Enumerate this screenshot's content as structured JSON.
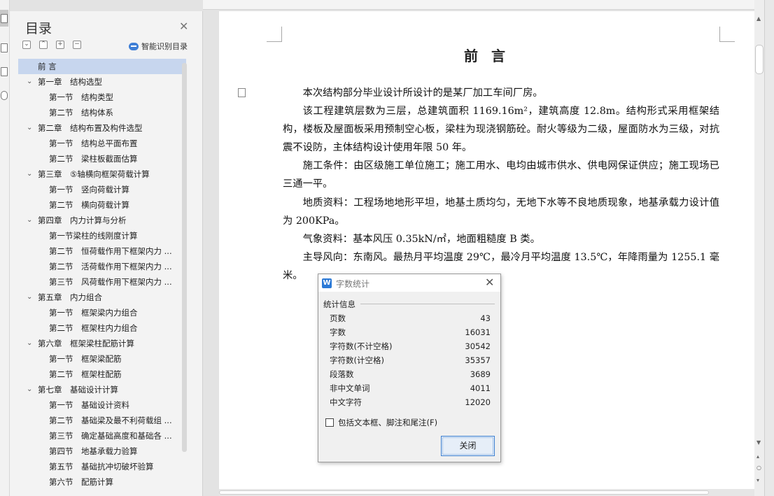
{
  "toc_panel": {
    "title": "目录",
    "smart_label": "智能识别目录",
    "items": [
      {
        "level": 1,
        "label": "前 言",
        "selected": true
      },
      {
        "level": 1,
        "label": "第一章　结构选型",
        "expanded": true
      },
      {
        "level": 2,
        "label": "第一节　结构类型"
      },
      {
        "level": 2,
        "label": "第二节　结构体系"
      },
      {
        "level": 1,
        "label": "第二章　结构布置及构件选型",
        "expanded": true
      },
      {
        "level": 2,
        "label": "第一节　结构总平面布置"
      },
      {
        "level": 2,
        "label": "第二节　梁柱板截面估算"
      },
      {
        "level": 1,
        "label": "第三章　⑤轴横向框架荷载计算",
        "expanded": true
      },
      {
        "level": 2,
        "label": "第一节　竖向荷载计算"
      },
      {
        "level": 2,
        "label": "第二节　横向荷载计算"
      },
      {
        "level": 1,
        "label": "第四章　内力计算与分析",
        "expanded": true
      },
      {
        "level": 2,
        "label": "第一节梁柱的线刚度计算"
      },
      {
        "level": 2,
        "label": "第二节　恒荷载作用下框架内力 ..."
      },
      {
        "level": 2,
        "label": "第二节　活荷载作用下框架内力 ..."
      },
      {
        "level": 2,
        "label": "第三节　风荷载作用下框架内力 ..."
      },
      {
        "level": 1,
        "label": "第五章　内力组合",
        "expanded": true
      },
      {
        "level": 2,
        "label": "第一节　框架梁内力组合"
      },
      {
        "level": 2,
        "label": "第二节　框架柱内力组合"
      },
      {
        "level": 1,
        "label": "第六章　框架梁柱配筋计算",
        "expanded": true
      },
      {
        "level": 2,
        "label": "第一节　框架梁配筋"
      },
      {
        "level": 2,
        "label": "第二节　框架柱配筋"
      },
      {
        "level": 1,
        "label": "第七章　基础设计计算",
        "expanded": true
      },
      {
        "level": 2,
        "label": "第一节　基础设计资料"
      },
      {
        "level": 2,
        "label": "第二节　基础梁及最不利荷载组 ..."
      },
      {
        "level": 2,
        "label": "第三节　确定基础高度和基础各 ..."
      },
      {
        "level": 2,
        "label": "第四节　地基承载力验算"
      },
      {
        "level": 2,
        "label": "第五节　基础抗冲切破坏验算"
      },
      {
        "level": 2,
        "label": "第六节　配筋计算"
      }
    ]
  },
  "document": {
    "title": "前 言",
    "paragraphs": [
      "本次结构部分毕业设计所设计的是某厂加工车间厂房。",
      "该工程建筑层数为三层，总建筑面积 1169.16m²，建筑高度 12.8m。结构形式采用框架结构，楼板及屋面板采用预制空心板，梁柱为现浇钢筋砼。耐火等级为二级，屋面防水为三级，对抗震不设防，主体结构设计使用年限 50 年。",
      "施工条件：由区级施工单位施工；施工用水、电均由城市供水、供电网保证供应；施工现场已三通一平。",
      "地质资料：工程场地地形平坦，地基土质均匀，无地下水等不良地质现象，地基承载力设计值为 200KPa。",
      "气象资料：基本风压 0.35kN/㎡，地面粗糙度 B 类。",
      "主导风向：东南风。最热月平均温度 29℃，最冷月平均温度 13.5℃，年降雨量为 1255.1 毫米。"
    ]
  },
  "word_count_dialog": {
    "title": "字数统计",
    "section_label": "统计信息",
    "stats": [
      {
        "label": "页数",
        "value": "43"
      },
      {
        "label": "字数",
        "value": "16031"
      },
      {
        "label": "字符数(不计空格)",
        "value": "30542"
      },
      {
        "label": "字符数(计空格)",
        "value": "35357"
      },
      {
        "label": "段落数",
        "value": "3689"
      },
      {
        "label": "非中文单词",
        "value": "4011"
      },
      {
        "label": "中文字符",
        "value": "12020"
      }
    ],
    "checkbox_label": "包括文本框、脚注和尾注(F)",
    "checkbox_checked": false,
    "close_button_label": "关闭"
  }
}
